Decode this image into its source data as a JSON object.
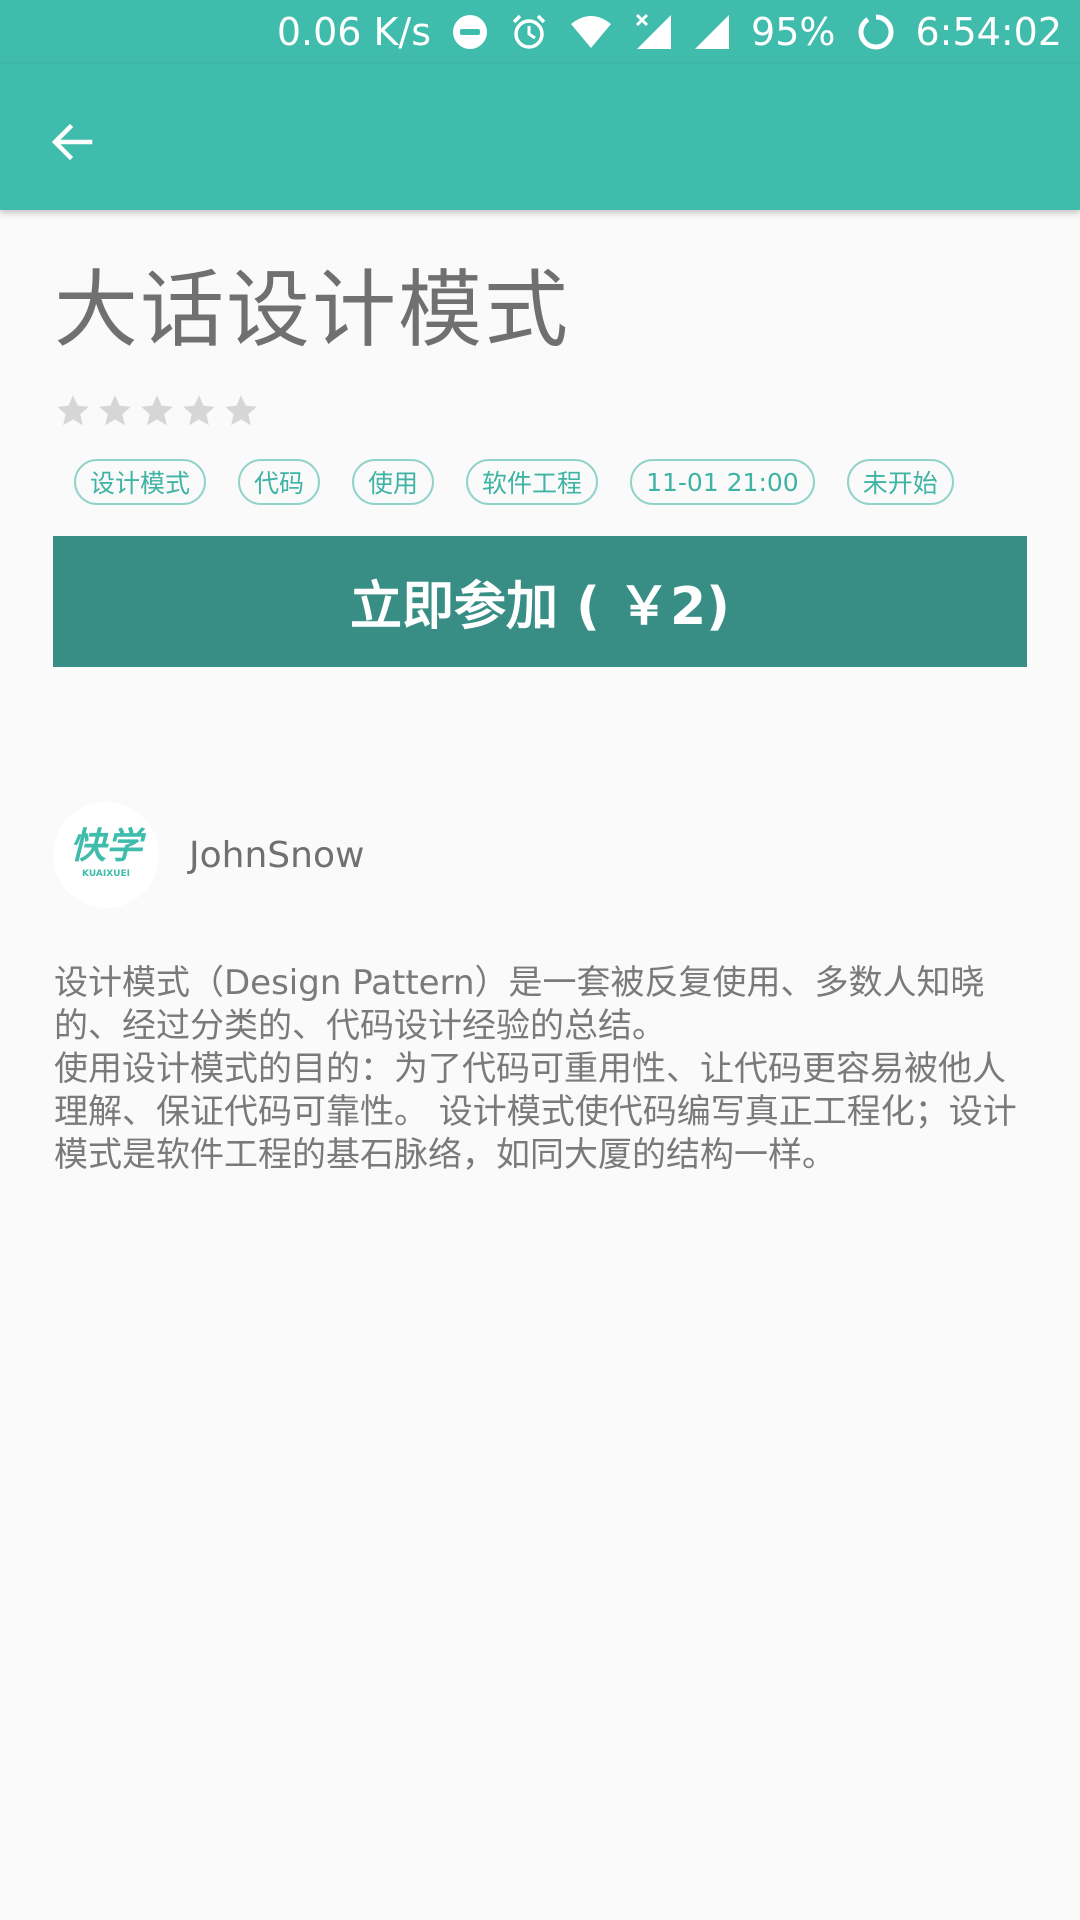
{
  "status_bar": {
    "speed": "0.06 K/s",
    "battery": "95%",
    "time": "6:54:02",
    "icons": [
      "dnd-icon",
      "alarm-icon",
      "wifi-icon",
      "signal-no-sim-icon",
      "signal-icon",
      "battery-ring-icon"
    ]
  },
  "app_bar": {
    "back_icon": "arrow-back-icon"
  },
  "course": {
    "title": "大话设计模式",
    "rating": 0,
    "rating_max": 5,
    "tags": [
      "设计模式",
      "代码",
      "使用",
      "软件工程",
      "11-01 21:00",
      "未开始"
    ],
    "join_button": "立即参加 ( ￥2)",
    "author": {
      "name": "JohnSnow",
      "avatar_text": "快学",
      "avatar_subtext": "KUAIXUEI"
    },
    "description": "设计模式（Design Pattern）是一套被反复使用、多数人知晓的、经过分类的、代码设计经验的总结。\n使用设计模式的目的：为了代码可重用性、让代码更容易被他人理解、保证代码可靠性。 设计模式使代码编写真正工程化；设计模式是软件工程的基石脉络，如同大厦的结构一样。"
  },
  "colors": {
    "primary": "#3fbcab",
    "button": "#388e85",
    "tag_border": "#8fd3c9",
    "tag_text": "#3fb4a4",
    "text_gray": "#707070",
    "star_empty": "#d6d6d6"
  }
}
